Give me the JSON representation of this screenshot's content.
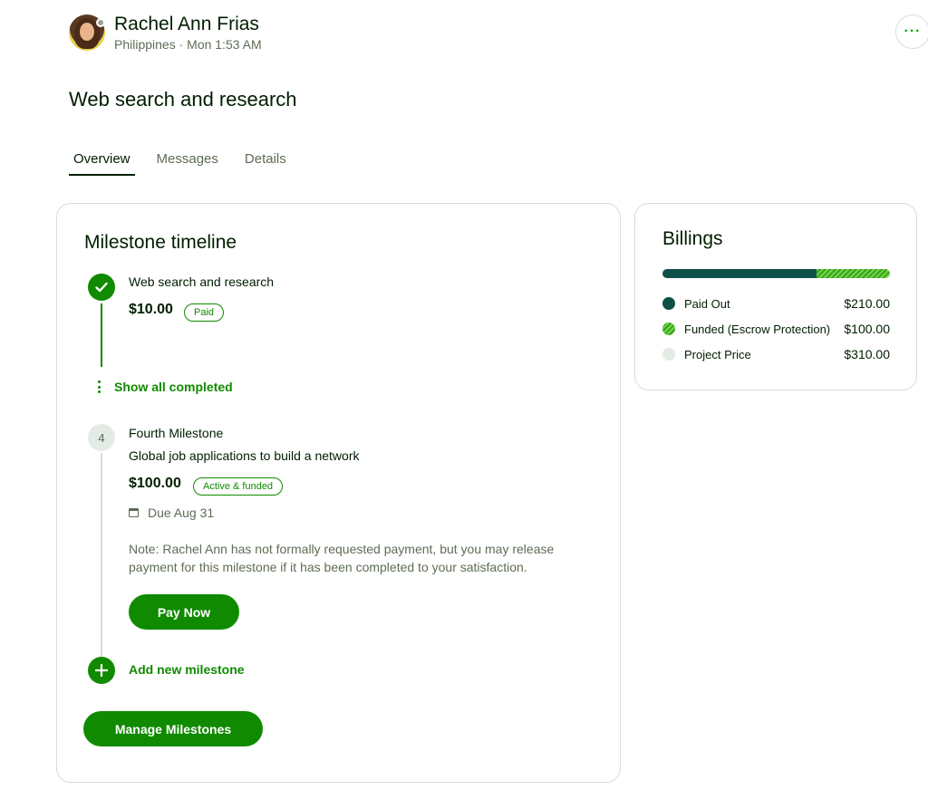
{
  "header": {
    "user_name": "Rachel Ann Frias",
    "user_meta": "Philippines · Mon 1:53 AM",
    "more_label": "···"
  },
  "job": {
    "title": "Web search and research"
  },
  "tabs": [
    {
      "label": "Overview",
      "active": true
    },
    {
      "label": "Messages",
      "active": false
    },
    {
      "label": "Details",
      "active": false
    }
  ],
  "milestones": {
    "title": "Milestone timeline",
    "completed": {
      "label": "Web search and research",
      "amount": "$10.00",
      "badge": "Paid"
    },
    "show_completed_label": "Show all completed",
    "current": {
      "number": "4",
      "name": "Fourth Milestone",
      "description": "Global job applications to build a network",
      "amount": "$100.00",
      "badge": "Active & funded",
      "due": "Due Aug 31",
      "note": "Note: Rachel Ann has not formally requested payment, but you may release payment for this milestone if it has been completed to your satisfaction.",
      "pay_label": "Pay Now"
    },
    "add_label": "Add new milestone",
    "manage_label": "Manage Milestones"
  },
  "billings": {
    "title": "Billings",
    "paid_out_value": 210,
    "funded_value": 100,
    "project_price_value": 310,
    "rows": [
      {
        "label": "Paid Out",
        "amount": "$210.00"
      },
      {
        "label": "Funded (Escrow Protection)",
        "amount": "$100.00"
      },
      {
        "label": "Project Price",
        "amount": "$310.00"
      }
    ]
  },
  "colors": {
    "brand_green": "#108a00",
    "paid_out": "#0e4f48",
    "funded": "#6fda44",
    "neutral": "#e4ebe4"
  }
}
